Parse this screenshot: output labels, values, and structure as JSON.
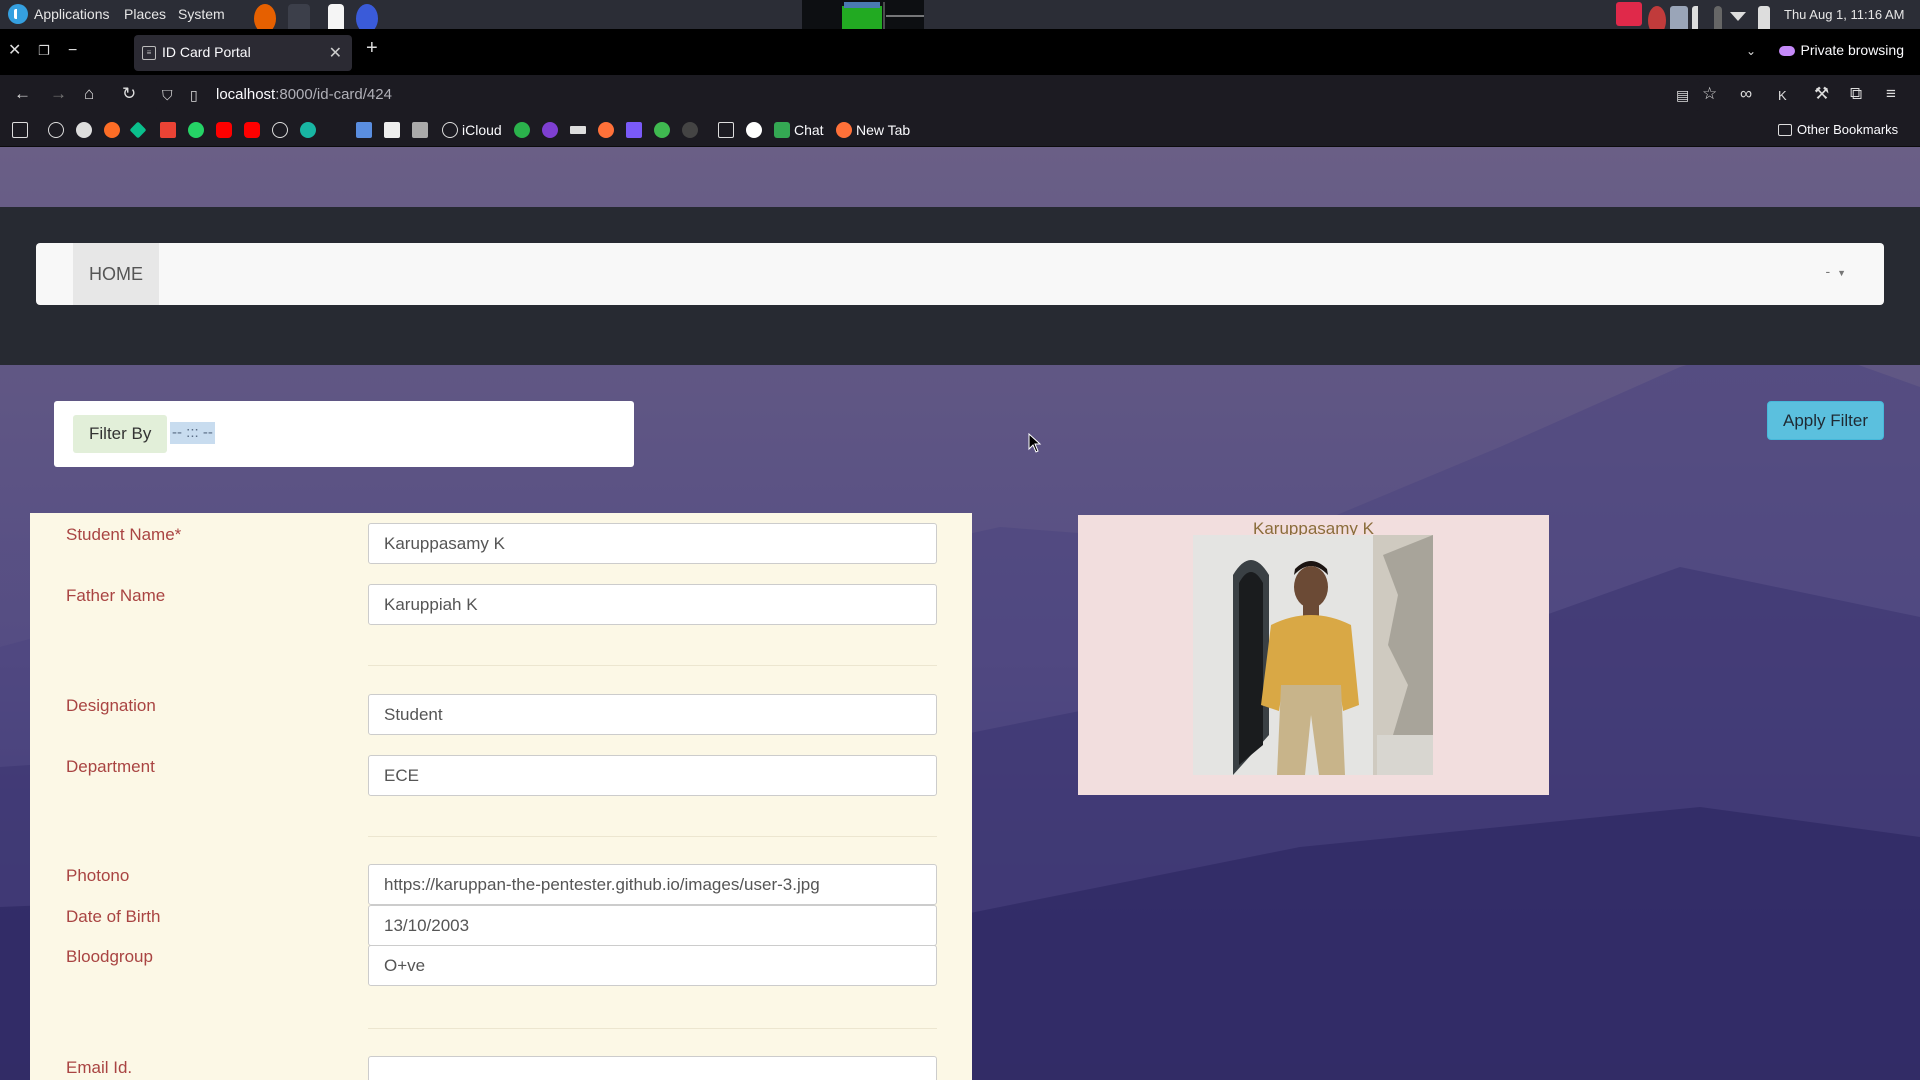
{
  "os_panel": {
    "menu": [
      "Applications",
      "Places",
      "System"
    ],
    "clock": "Thu Aug  1, 11:16 AM"
  },
  "browser": {
    "tab_title": "ID Card Portal",
    "private_label": "Private browsing",
    "url_host": "localhost",
    "url_rest": ":8000/id-card/424",
    "bookmarks": {
      "icloud": "iCloud",
      "chat": "Chat",
      "new_tab": "New Tab",
      "other": "Other Bookmarks"
    }
  },
  "nav": {
    "home": "HOME",
    "user_dropdown": "-"
  },
  "filter": {
    "label": "Filter By",
    "selected": "-- ::: --",
    "apply": "Apply Filter"
  },
  "form": {
    "student_name_label": "Student Name*",
    "student_name": "Karuppasamy K",
    "father_name_label": "Father Name",
    "father_name": "Karuppiah K",
    "designation_label": "Designation",
    "designation": "Student",
    "department_label": "Department",
    "department": "ECE",
    "photono_label": "Photono",
    "photono": "https://karuppan-the-pentester.github.io/images/user-3.jpg",
    "dob_label": "Date of Birth",
    "dob": "13/10/2003",
    "bloodgroup_label": "Bloodgroup",
    "bloodgroup": "O+ve",
    "email_label": "Email Id.",
    "email": ""
  },
  "card": {
    "name": "Karuppasamy K"
  },
  "colors": {
    "label_red": "#a94442",
    "apply_button": "#5bc0de",
    "form_bg": "#fcf8e6",
    "card_bg": "#f2dede"
  }
}
